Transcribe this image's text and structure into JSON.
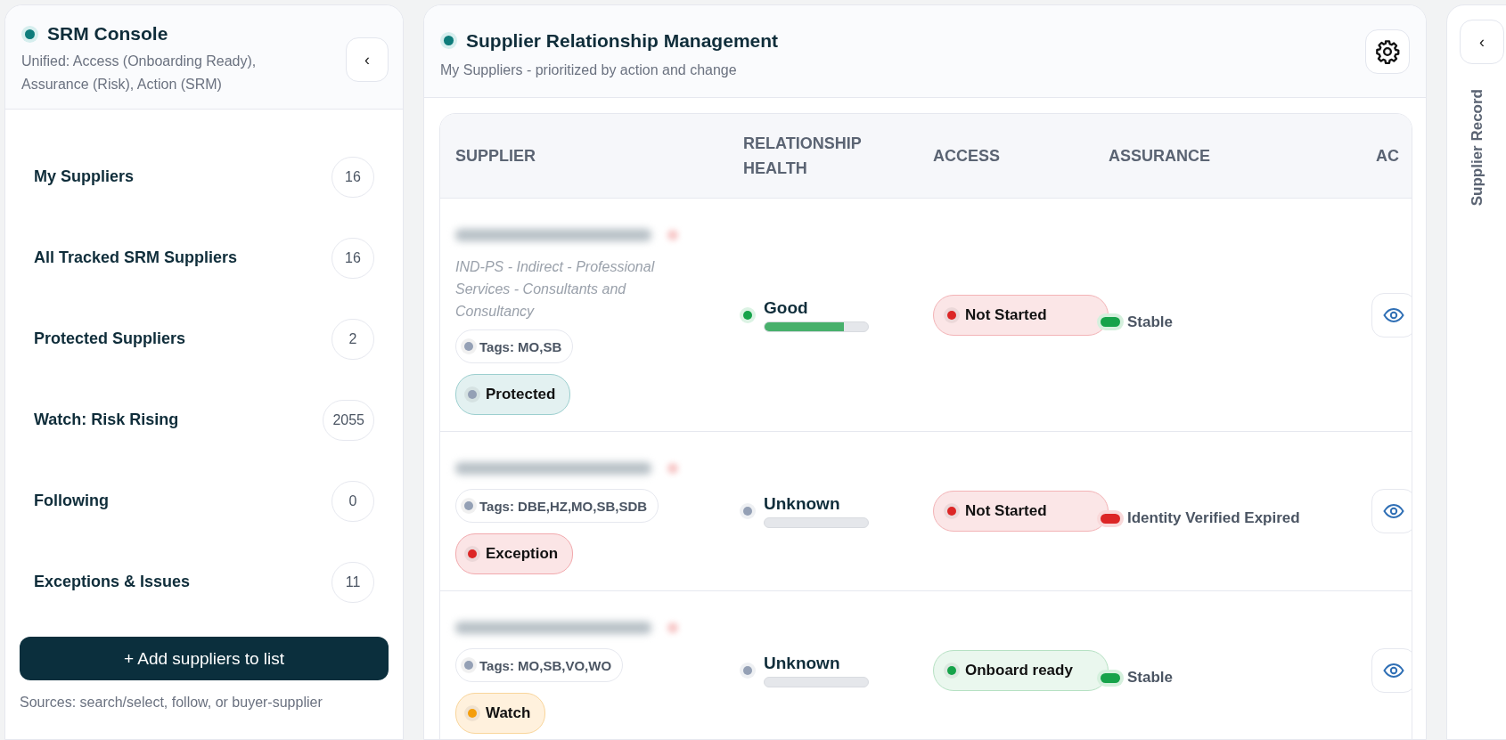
{
  "sidebar": {
    "title": "SRM Console",
    "subtitle": "Unified: Access (Onboarding Ready), Assurance (Risk), Action (SRM)",
    "collapse": "‹",
    "items": [
      {
        "label": "My Suppliers",
        "count": "16"
      },
      {
        "label": "All Tracked SRM Suppliers",
        "count": "16"
      },
      {
        "label": "Protected Suppliers",
        "count": "2"
      },
      {
        "label": "Watch: Risk Rising",
        "count": "2055"
      },
      {
        "label": "Following",
        "count": "0"
      },
      {
        "label": "Exceptions & Issues",
        "count": "11"
      }
    ],
    "add_button": "+ Add suppliers to list",
    "sources_note": "Sources: search/select, follow, or buyer-supplier"
  },
  "main": {
    "title": "Supplier Relationship Management",
    "subtitle": "My Suppliers - prioritized by action and change",
    "table": {
      "columns": [
        "SUPPLIER",
        "RELATIONSHIP HEALTH",
        "ACCESS",
        "ASSURANCE",
        "AC"
      ],
      "rows": [
        {
          "category": "IND-PS - Indirect - Professional Services - Consultants and Consultancy",
          "tags": "Tags: MO,SB",
          "status": {
            "label": "Protected",
            "kind": "protected"
          },
          "health": {
            "label": "Good",
            "kind": "good",
            "level": 0.77
          },
          "access": {
            "label": "Not Started",
            "kind": "notstarted"
          },
          "assurance": {
            "label": "Stable",
            "kind": "stable"
          }
        },
        {
          "tags": "Tags: DBE,HZ,MO,SB,SDB",
          "status": {
            "label": "Exception",
            "kind": "exception"
          },
          "health": {
            "label": "Unknown",
            "kind": "unknown",
            "level": 0
          },
          "access": {
            "label": "Not Started",
            "kind": "notstarted"
          },
          "assurance": {
            "label": "Identity Verified Expired",
            "kind": "expired"
          }
        },
        {
          "tags": "Tags: MO,SB,VO,WO",
          "status": {
            "label": "Watch",
            "kind": "watch"
          },
          "health": {
            "label": "Unknown",
            "kind": "unknown",
            "level": 0
          },
          "access": {
            "label": "Onboard ready",
            "kind": "ready"
          },
          "assurance": {
            "label": "Stable",
            "kind": "stable"
          }
        }
      ]
    }
  },
  "record_panel": {
    "collapse": "‹",
    "title": "Supplier Record"
  }
}
